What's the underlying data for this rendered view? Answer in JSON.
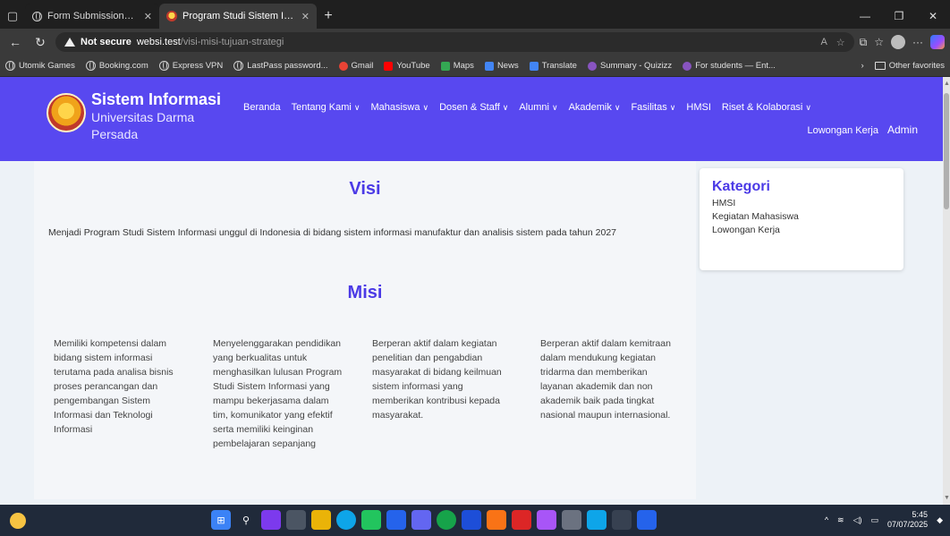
{
  "browser": {
    "tabs": [
      {
        "label": "Form Submissions - Sistem Inform"
      },
      {
        "label": "Program Studi Sistem Informasi"
      }
    ],
    "address": {
      "security_label": "Not secure",
      "host": "websi.test",
      "path": "/visi-misi-tujuan-strategi"
    },
    "bookmarks": [
      {
        "label": "Utomik Games",
        "color": "#9aa0a6"
      },
      {
        "label": "Booking.com",
        "color": "#9aa0a6"
      },
      {
        "label": "Express VPN",
        "color": "#9aa0a6"
      },
      {
        "label": "LastPass password...",
        "color": "#9aa0a6"
      },
      {
        "label": "Gmail",
        "color": "#ea4335"
      },
      {
        "label": "YouTube",
        "color": "#ff0000"
      },
      {
        "label": "Maps",
        "color": "#34a853"
      },
      {
        "label": "News",
        "color": "#4285f4"
      },
      {
        "label": "Translate",
        "color": "#4285f4"
      },
      {
        "label": "Summary - Quizizz",
        "color": "#8854c0"
      },
      {
        "label": "For students — Ent...",
        "color": "#8854c0"
      }
    ],
    "other_favorites": "Other favorites"
  },
  "site": {
    "brand": {
      "title": "Sistem Informasi",
      "sub1": "Universitas Darma",
      "sub2": "Persada"
    },
    "nav": [
      {
        "label": "Beranda",
        "dropdown": false
      },
      {
        "label": "Tentang Kami",
        "dropdown": true
      },
      {
        "label": "Mahasiswa",
        "dropdown": true
      },
      {
        "label": "Dosen & Staff",
        "dropdown": true
      },
      {
        "label": "Alumni",
        "dropdown": true
      },
      {
        "label": "Akademik",
        "dropdown": true
      },
      {
        "label": "Fasilitas",
        "dropdown": true
      },
      {
        "label": "HMSI",
        "dropdown": false
      },
      {
        "label": "Riset & Kolaborasi",
        "dropdown": true
      }
    ],
    "nav2": {
      "lowongan": "Lowongan Kerja",
      "admin": "Admin"
    }
  },
  "main": {
    "visi_heading": "Visi",
    "visi_text": "Menjadi Program Studi Sistem Informasi unggul di Indonesia di bidang sistem informasi manufaktur dan analisis sistem pada tahun 2027",
    "misi_heading": "Misi",
    "misi": [
      "Memiliki kompetensi dalam bidang sistem informasi terutama pada analisa bisnis proses perancangan dan pengembangan Sistem Informasi dan Teknologi Informasi",
      "Menyelenggarakan pendidikan yang berkualitas untuk menghasilkan lulusan Program Studi Sistem Informasi yang mampu bekerjasama dalam tim, komunikator yang efektif serta memiliki keinginan pembelajaran sepanjang",
      "Berperan aktif dalam kegiatan penelitian dan pengabdian masyarakat di bidang keilmuan sistem informasi yang memberikan kontribusi kepada masyarakat.",
      "Berperan aktif dalam kemitraan dalam mendukung kegiatan tridarma dan memberikan layanan akademik dan non akademik baik pada tingkat nasional maupun internasional."
    ]
  },
  "sidebar": {
    "title": "Kategori",
    "items": [
      "HMSI",
      "Kegiatan Mahasiswa",
      "Lowongan Kerja"
    ]
  },
  "taskbar": {
    "time": "5:45",
    "date": "07/07/2025"
  }
}
